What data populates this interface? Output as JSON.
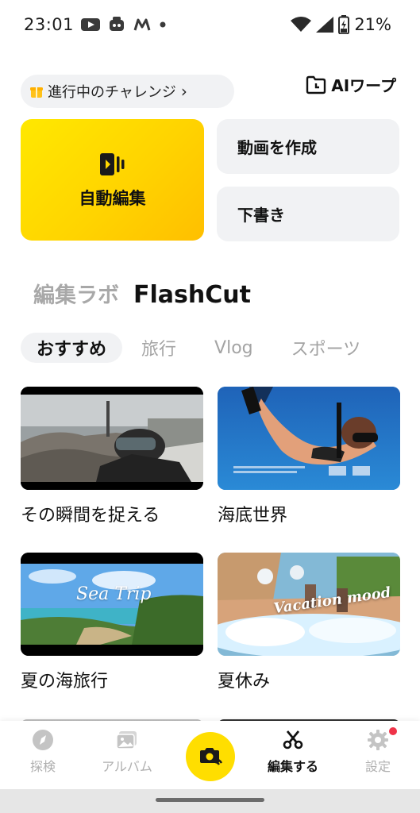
{
  "status_bar": {
    "time": "23:01",
    "battery": "21%",
    "icons": [
      "youtube-icon",
      "app-icon",
      "m-icon",
      "dot-icon",
      "wifi-icon",
      "signal-icon",
      "battery-icon"
    ]
  },
  "header": {
    "challenge_label": "進行中のチャレンジ",
    "challenge_chevron": "›",
    "ai_warp_label": "AIワープ"
  },
  "actions": {
    "auto_edit": "自動編集",
    "create_video": "動画を作成",
    "draft": "下書き"
  },
  "section_tabs": {
    "lab": "編集ラボ",
    "flashcut": "FlashCut"
  },
  "chips": [
    "おすすめ",
    "旅行",
    "Vlog",
    "スポーツ"
  ],
  "tiles": [
    {
      "title": "その瞬間を捉える"
    },
    {
      "title": "海底世界"
    },
    {
      "title": "夏の海旅行",
      "overlay": "Sea Trip"
    },
    {
      "title": "夏休み",
      "overlay": "Vacation mood"
    }
  ],
  "bottom_nav": {
    "explore": "探検",
    "album": "アルバム",
    "edit": "編集する",
    "settings": "設定"
  },
  "colors": {
    "accent": "#ffde00",
    "chip_bg": "#f1f2f4",
    "notification": "#ef3348"
  }
}
